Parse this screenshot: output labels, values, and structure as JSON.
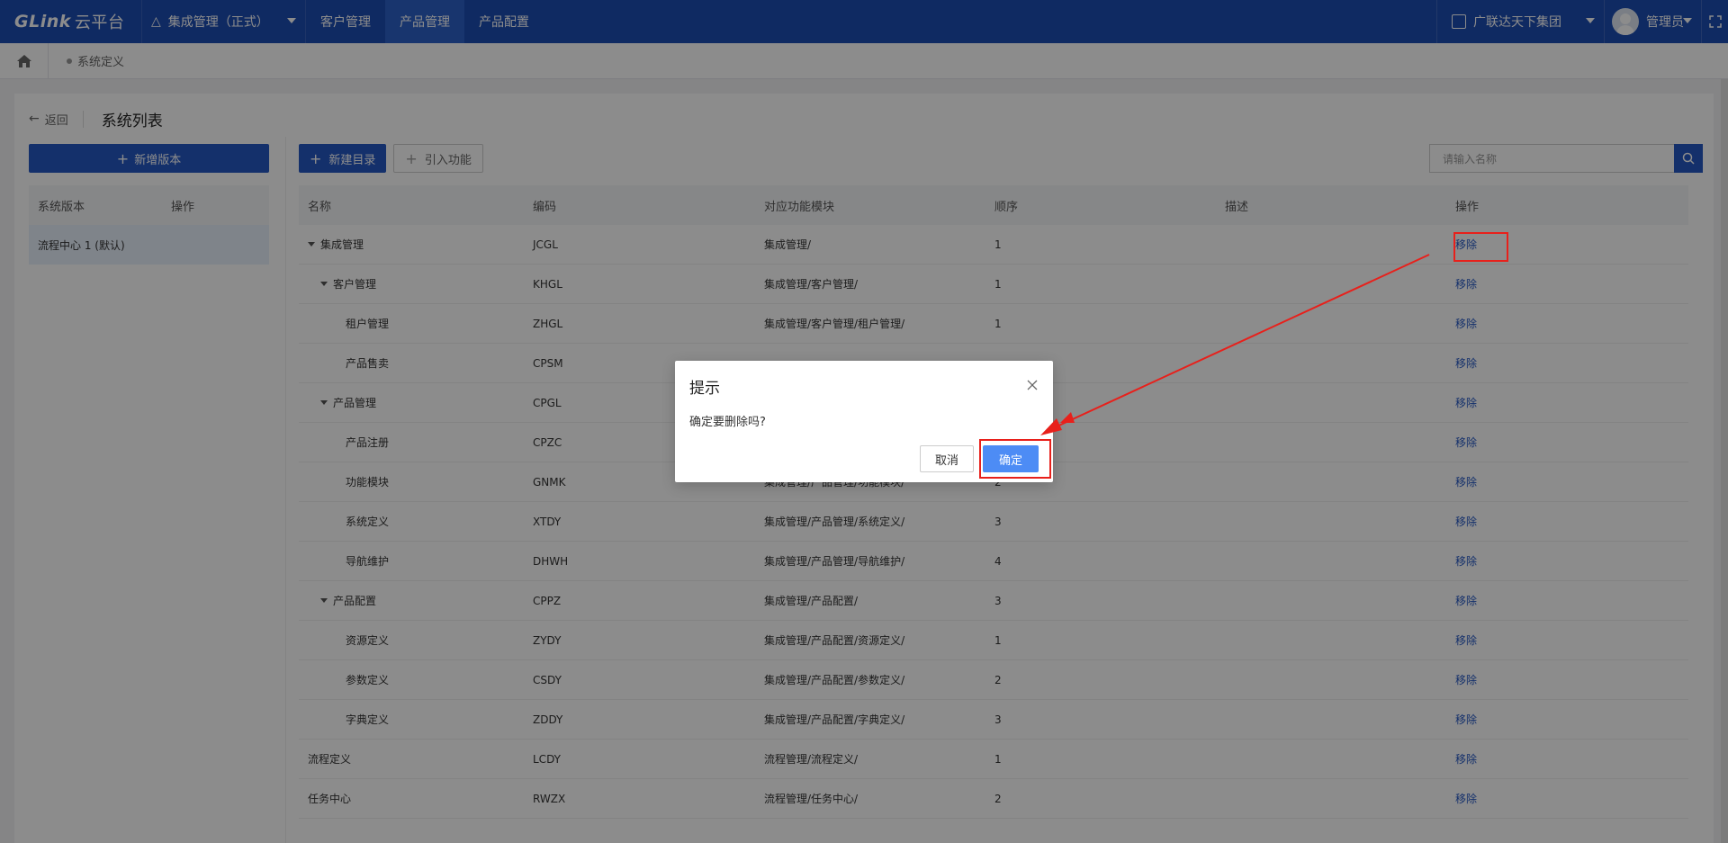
{
  "topbar": {
    "logo": "GLink",
    "logo_sub": "云平台",
    "system": "集成管理（正式）",
    "nav": [
      "客户管理",
      "产品管理",
      "产品配置"
    ],
    "active_nav": "产品管理",
    "org": "广联达天下集团",
    "user": "管理员"
  },
  "breadcrumb": {
    "current": "系统定义"
  },
  "page": {
    "back_label": "返回",
    "title": "系统列表"
  },
  "left": {
    "add_version_label": "新增版本",
    "columns": [
      "系统版本",
      "操作"
    ],
    "rows": [
      {
        "version": "流程中心 1 (默认)",
        "op": ""
      }
    ]
  },
  "toolbar": {
    "new_dir_label": "新建目录",
    "import_label": "引入功能",
    "search_placeholder": "请输入名称"
  },
  "table": {
    "columns": [
      "名称",
      "编码",
      "对应功能模块",
      "顺序",
      "描述",
      "操作"
    ],
    "rows": [
      {
        "name": "集成管理",
        "code": "JCGL",
        "module": "集成管理/",
        "order": "1",
        "desc": "",
        "op": "移除",
        "level": 1,
        "expanded": true
      },
      {
        "name": "客户管理",
        "code": "KHGL",
        "module": "集成管理/客户管理/",
        "order": "1",
        "desc": "",
        "op": "移除",
        "level": 2,
        "expanded": true
      },
      {
        "name": "租户管理",
        "code": "ZHGL",
        "module": "集成管理/客户管理/租户管理/",
        "order": "1",
        "desc": "",
        "op": "移除",
        "level": 3
      },
      {
        "name": "产品售卖",
        "code": "CPSM",
        "module": "",
        "order": "",
        "desc": "",
        "op": "移除",
        "level": 3
      },
      {
        "name": "产品管理",
        "code": "CPGL",
        "module": "",
        "order": "",
        "desc": "",
        "op": "移除",
        "level": 2,
        "expanded": true
      },
      {
        "name": "产品注册",
        "code": "CPZC",
        "module": "",
        "order": "",
        "desc": "",
        "op": "移除",
        "level": 3
      },
      {
        "name": "功能模块",
        "code": "GNMK",
        "module": "集成管理/产品管理/功能模块/",
        "order": "2",
        "desc": "",
        "op": "移除",
        "level": 3
      },
      {
        "name": "系统定义",
        "code": "XTDY",
        "module": "集成管理/产品管理/系统定义/",
        "order": "3",
        "desc": "",
        "op": "移除",
        "level": 3
      },
      {
        "name": "导航维护",
        "code": "DHWH",
        "module": "集成管理/产品管理/导航维护/",
        "order": "4",
        "desc": "",
        "op": "移除",
        "level": 3
      },
      {
        "name": "产品配置",
        "code": "CPPZ",
        "module": "集成管理/产品配置/",
        "order": "3",
        "desc": "",
        "op": "移除",
        "level": 2,
        "expanded": true
      },
      {
        "name": "资源定义",
        "code": "ZYDY",
        "module": "集成管理/产品配置/资源定义/",
        "order": "1",
        "desc": "",
        "op": "移除",
        "level": 3
      },
      {
        "name": "参数定义",
        "code": "CSDY",
        "module": "集成管理/产品配置/参数定义/",
        "order": "2",
        "desc": "",
        "op": "移除",
        "level": 3
      },
      {
        "name": "字典定义",
        "code": "ZDDY",
        "module": "集成管理/产品配置/字典定义/",
        "order": "3",
        "desc": "",
        "op": "移除",
        "level": 3
      },
      {
        "name": "流程定义",
        "code": "LCDY",
        "module": "流程管理/流程定义/",
        "order": "1",
        "desc": "",
        "op": "移除",
        "level": 0
      },
      {
        "name": "任务中心",
        "code": "RWZX",
        "module": "流程管理/任务中心/",
        "order": "2",
        "desc": "",
        "op": "移除",
        "level": 0
      }
    ]
  },
  "dialog": {
    "title": "提示",
    "message": "确定要删除吗?",
    "cancel_label": "取消",
    "ok_label": "确定"
  },
  "colors": {
    "nav_bg": "#1d4db3",
    "primary": "#2558c4",
    "ok_button": "#4d8cf5",
    "annotation": "#e8201b"
  }
}
